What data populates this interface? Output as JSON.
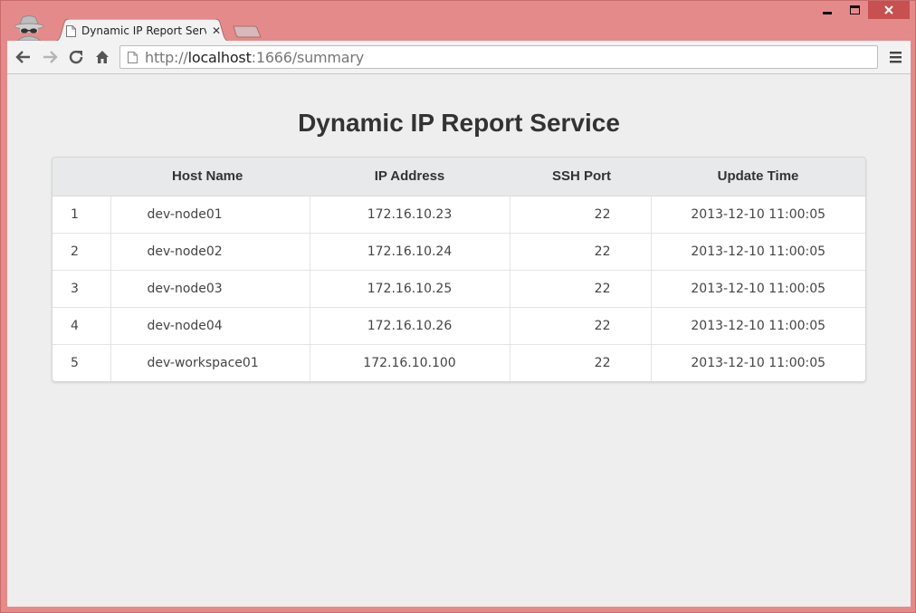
{
  "browser": {
    "tab": {
      "title": "Dynamic IP Report Service",
      "close": "✕"
    },
    "window_controls": {
      "minimize": "▁",
      "maximize": "▢",
      "close": "✕"
    },
    "address_bar": {
      "scheme": "http://",
      "host": "localhost",
      "path": ":1666/summary"
    }
  },
  "page": {
    "title": "Dynamic IP Report Service",
    "table": {
      "columns": [
        "",
        "Host Name",
        "IP Address",
        "SSH Port",
        "Update Time"
      ],
      "rows": [
        {
          "index": "1",
          "host": "dev-node01",
          "ip": "172.16.10.23",
          "port": "22",
          "time": "2013-12-10 11:00:05"
        },
        {
          "index": "2",
          "host": "dev-node02",
          "ip": "172.16.10.24",
          "port": "22",
          "time": "2013-12-10 11:00:05"
        },
        {
          "index": "3",
          "host": "dev-node03",
          "ip": "172.16.10.25",
          "port": "22",
          "time": "2013-12-10 11:00:05"
        },
        {
          "index": "4",
          "host": "dev-node04",
          "ip": "172.16.10.26",
          "port": "22",
          "time": "2013-12-10 11:00:05"
        },
        {
          "index": "5",
          "host": "dev-workspace01",
          "ip": "172.16.10.100",
          "port": "22",
          "time": "2013-12-10 11:00:05"
        }
      ]
    }
  },
  "colors": {
    "frame": "#e58a8a",
    "page_bg": "#eeeeee",
    "header_bg": "#e8e9ea"
  },
  "icons": {
    "incognito": "incognito-icon",
    "back": "back-arrow-icon",
    "forward": "forward-arrow-icon",
    "reload": "reload-icon",
    "home": "home-icon",
    "page": "page-icon",
    "menu": "hamburger-menu-icon"
  }
}
